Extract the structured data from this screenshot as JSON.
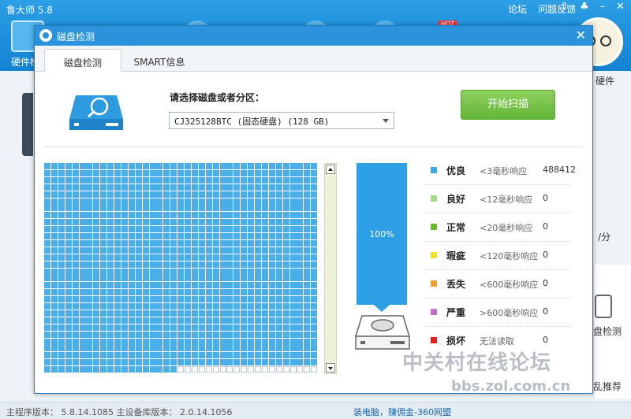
{
  "app": {
    "title": "鲁大师 5.8",
    "links": [
      "论坛",
      "问题反馈"
    ],
    "hardware_tab_label": "硬件检",
    "hot_badge": "HOT",
    "right_labels": [
      "硬件",
      "/分",
      "盘检测",
      "乱推荐"
    ]
  },
  "status_bar": {
    "versions": "主程序版本：  5.8.14.1085    主设备库版本：  2.0.14.1056",
    "promo": "装电脑，赚佣金-360网盟"
  },
  "dialog": {
    "title": "磁盘检测",
    "tabs": [
      {
        "label": "磁盘检测",
        "active": true
      },
      {
        "label": "SMART信息",
        "active": false
      }
    ],
    "select_label": "请选择磁盘或者分区：",
    "selected_disk": "CJ325128BTC (固态硬盘)  (128 GB)",
    "scan_button": "开始扫描",
    "progress": {
      "text": "100%",
      "value": 1.0
    },
    "grid": {
      "rows": 30,
      "cols": 39,
      "total_cells": 1170,
      "unfilled_tail": 20,
      "filled_color": "#4aaee8",
      "empty_color": "#ffffff"
    },
    "legend": [
      {
        "name": "优良",
        "desc": "<3毫秒响应",
        "count": "488412",
        "color": "#3aa8e6"
      },
      {
        "name": "良好",
        "desc": "<12毫秒响应",
        "count": "0",
        "color": "#a6d98a"
      },
      {
        "name": "正常",
        "desc": "<20毫秒响应",
        "count": "0",
        "color": "#6cb82e"
      },
      {
        "name": "瑕疵",
        "desc": "<120毫秒响应",
        "count": "0",
        "color": "#f0e030"
      },
      {
        "name": "丢失",
        "desc": "<600毫秒响应",
        "count": "0",
        "color": "#f0a030"
      },
      {
        "name": "严重",
        "desc": ">600毫秒响应",
        "count": "0",
        "color": "#c070c8"
      },
      {
        "name": "损坏",
        "desc": "无法读取",
        "count": "0",
        "color": "#e02020"
      }
    ]
  },
  "watermark": {
    "line1": "中关村在线论坛",
    "line2": "bbs.zol.com.cn"
  }
}
